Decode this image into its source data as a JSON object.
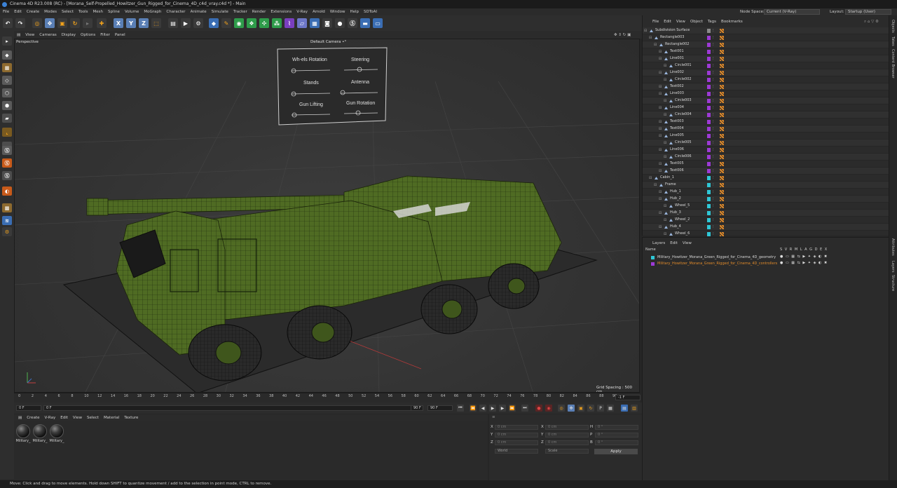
{
  "title": "Cinema 4D R23.008 (RC) - [Morana_Self-Propelled_Howitzer_Gun_Rigged_for_Cinema_4D_c4d_vray.c4d *] - Main",
  "menu": [
    "File",
    "Edit",
    "Create",
    "Modes",
    "Select",
    "Tools",
    "Mesh",
    "Spline",
    "Volume",
    "MoGraph",
    "Character",
    "Animate",
    "Simulate",
    "Tracker",
    "Render",
    "Extensions",
    "V-Ray",
    "Arnold",
    "Window",
    "Help",
    "SDToAI"
  ],
  "node_space_label": "Node Space:",
  "node_space_value": "Current (V-Ray)",
  "layout_label": "Layout:",
  "layout_value": "Startup (User)",
  "toolbar": {
    "x": "X",
    "y": "Y",
    "z": "Z"
  },
  "viewport_menu": [
    "View",
    "Cameras",
    "Display",
    "Options",
    "Filter",
    "Panel"
  ],
  "viewport": {
    "view_name": "Perspective",
    "camera": "Default Camera •°",
    "grid_spacing": "Grid Spacing : 500 cm",
    "controls": [
      "Wh-els Rotation",
      "Steering",
      "Stands",
      "Antenna",
      "Gun Lifting",
      "Gun Rotation"
    ]
  },
  "timeline": {
    "ticks": [
      "0",
      "2",
      "4",
      "6",
      "8",
      "10",
      "12",
      "14",
      "16",
      "18",
      "20",
      "22",
      "24",
      "26",
      "28",
      "30",
      "32",
      "34",
      "36",
      "38",
      "40",
      "42",
      "44",
      "46",
      "48",
      "50",
      "52",
      "54",
      "56",
      "58",
      "60",
      "62",
      "64",
      "66",
      "68",
      "70",
      "72",
      "74",
      "76",
      "78",
      "80",
      "82",
      "84",
      "86",
      "88",
      "90"
    ],
    "frame_field": "-1 F"
  },
  "playback": {
    "current": "0 F",
    "start": "0 F",
    "end": "90 F",
    "end2": "90 F"
  },
  "material_menu": [
    "Create",
    "V-Ray",
    "Edit",
    "View",
    "Select",
    "Material",
    "Texture"
  ],
  "materials": [
    "Military_",
    "Military_",
    "Military_"
  ],
  "attributes": {
    "rows": [
      {
        "a": "X",
        "av": "0 cm",
        "b": "X",
        "bv": "0 cm",
        "c": "H",
        "cv": "0 °"
      },
      {
        "a": "Y",
        "av": "0 cm",
        "b": "Y",
        "bv": "0 cm",
        "c": "P",
        "cv": "0 °"
      },
      {
        "a": "Z",
        "av": "0 cm",
        "b": "Z",
        "bv": "0 cm",
        "c": "B",
        "cv": "0 °"
      }
    ],
    "coord_mode": "World",
    "scale_mode": "Scale",
    "apply": "Apply"
  },
  "status": "Move: Click and drag to move elements. Hold down SHIFT to quantize movement / add to the selection in point mode, CTRL to remove.",
  "object_menu": [
    "File",
    "Edit",
    "View",
    "Object",
    "Tags",
    "Bookmarks"
  ],
  "objects": [
    {
      "name": "Subdivision Surface",
      "indent": 0,
      "color": "#8a8a8a"
    },
    {
      "name": "Rectangle003",
      "indent": 1,
      "color": "#9d3ad6"
    },
    {
      "name": "Rectangle002",
      "indent": 2,
      "color": "#9d3ad6"
    },
    {
      "name": "Text001",
      "indent": 3,
      "color": "#9d3ad6"
    },
    {
      "name": "Line001",
      "indent": 3,
      "color": "#9d3ad6"
    },
    {
      "name": "Circle001",
      "indent": 4,
      "color": "#9d3ad6"
    },
    {
      "name": "Line002",
      "indent": 3,
      "color": "#9d3ad6"
    },
    {
      "name": "Circle002",
      "indent": 4,
      "color": "#9d3ad6"
    },
    {
      "name": "Text002",
      "indent": 3,
      "color": "#9d3ad6"
    },
    {
      "name": "Line003",
      "indent": 3,
      "color": "#9d3ad6"
    },
    {
      "name": "Circle003",
      "indent": 4,
      "color": "#9d3ad6"
    },
    {
      "name": "Line004",
      "indent": 3,
      "color": "#9d3ad6"
    },
    {
      "name": "Circle004",
      "indent": 4,
      "color": "#9d3ad6"
    },
    {
      "name": "Text003",
      "indent": 3,
      "color": "#9d3ad6"
    },
    {
      "name": "Text004",
      "indent": 3,
      "color": "#9d3ad6"
    },
    {
      "name": "Line005",
      "indent": 3,
      "color": "#9d3ad6"
    },
    {
      "name": "Circle005",
      "indent": 4,
      "color": "#9d3ad6"
    },
    {
      "name": "Line006",
      "indent": 3,
      "color": "#9d3ad6"
    },
    {
      "name": "Circle006",
      "indent": 4,
      "color": "#9d3ad6"
    },
    {
      "name": "Text005",
      "indent": 3,
      "color": "#9d3ad6"
    },
    {
      "name": "Text006",
      "indent": 3,
      "color": "#9d3ad6"
    },
    {
      "name": "Cabin_1",
      "indent": 1,
      "color": "#2fc7d6"
    },
    {
      "name": "Frame",
      "indent": 2,
      "color": "#2fc7d6"
    },
    {
      "name": "Hub_1",
      "indent": 3,
      "color": "#2fc7d6"
    },
    {
      "name": "Hub_2",
      "indent": 3,
      "color": "#2fc7d6"
    },
    {
      "name": "Wheel_5",
      "indent": 4,
      "color": "#2fc7d6"
    },
    {
      "name": "Hub_3",
      "indent": 3,
      "color": "#2fc7d6"
    },
    {
      "name": "Wheel_2",
      "indent": 4,
      "color": "#2fc7d6"
    },
    {
      "name": "Hub_4",
      "indent": 3,
      "color": "#2fc7d6"
    },
    {
      "name": "Wheel_6",
      "indent": 4,
      "color": "#2fc7d6"
    }
  ],
  "layer_menu": [
    "Layers",
    "Edit",
    "View"
  ],
  "layer_header": {
    "name": "Name",
    "cols": "S V R M L A G D E X"
  },
  "layers": [
    {
      "name": "Military_Howitzer_Morana_Green_Rigged_for_Cinema_4D_geometry",
      "color": "#2fc7d6",
      "text_color": "#d6d6d6"
    },
    {
      "name": "Military_Howitzer_Morana_Green_Rigged_for_Cinema_4D_controllers",
      "color": "#9d3ad6",
      "text_color": "#e08a2a"
    }
  ],
  "right_tabs": [
    "Objects",
    "Takes",
    "Content Browser",
    "Attributes",
    "Layers",
    "Structure"
  ]
}
